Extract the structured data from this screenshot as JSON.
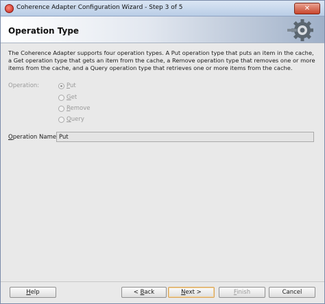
{
  "window": {
    "title": "Coherence Adapter Configuration Wizard - Step 3 of 5",
    "close_label": "✕"
  },
  "header": {
    "title": "Operation Type",
    "icon": "gear-icon"
  },
  "description": "The Coherence Adapter supports four operation types. A Put operation type that puts an item in the cache, a Get operation type that gets an item from the cache, a Remove operation type that removes one or more items from the cache, and a Query operation type that retrieves one or more items from the cache.",
  "operation": {
    "label": "Operation:",
    "options": [
      {
        "first": "P",
        "rest": "ut",
        "selected": true
      },
      {
        "first": "G",
        "rest": "et",
        "selected": false
      },
      {
        "first": "R",
        "rest": "emove",
        "selected": false
      },
      {
        "first": "Q",
        "rest": "uery",
        "selected": false
      }
    ]
  },
  "operation_name": {
    "label_first": "O",
    "label_rest": "peration Name:",
    "value": "Put"
  },
  "buttons": {
    "help_first": "H",
    "help_rest": "elp",
    "back_prefix": "< ",
    "back_first": "B",
    "back_rest": "ack",
    "next_first": "N",
    "next_rest": "ext >",
    "finish_first": "F",
    "finish_rest": "inish",
    "cancel": "Cancel"
  }
}
